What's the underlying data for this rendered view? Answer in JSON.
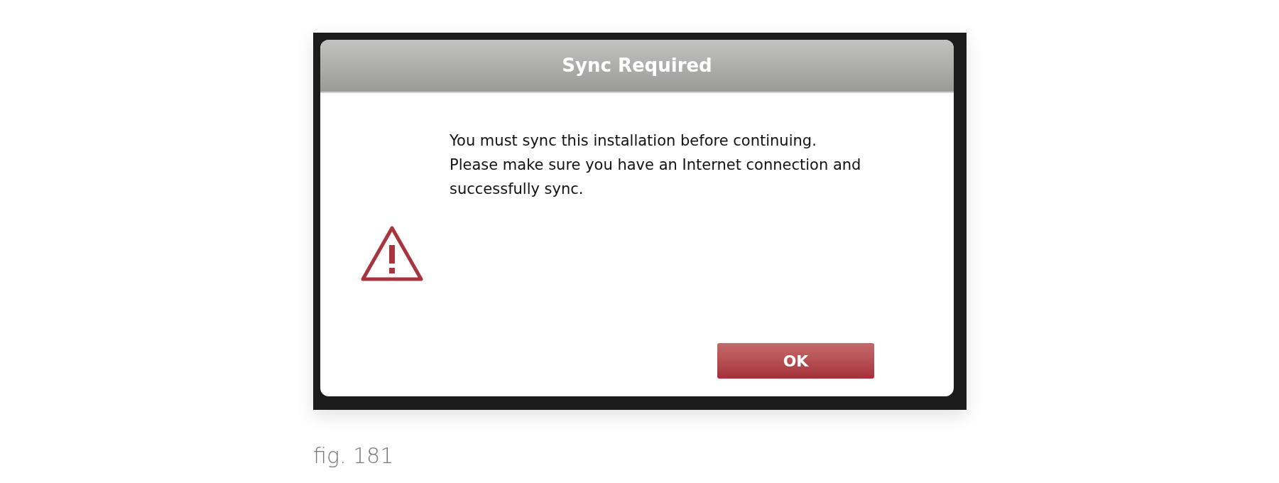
{
  "dialog": {
    "title": "Sync Required",
    "message": [
      "You must sync this installation before continuing.",
      "Please make sure you have an Internet connection and",
      "successfully sync."
    ],
    "buttons": [
      {
        "label": "OK",
        "kind": "primary"
      }
    ]
  },
  "caption": "fig. 181"
}
